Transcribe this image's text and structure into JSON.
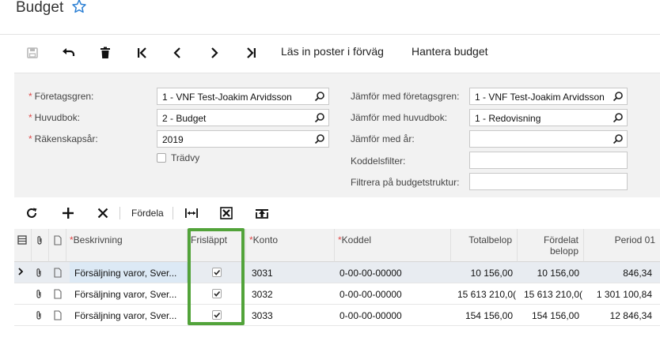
{
  "app": {
    "title": "Budget",
    "favorite_icon": "star-outline-icon",
    "accent": "#2a7fd4"
  },
  "toolbar": {
    "save_icon": "save-icon",
    "undo_icon": "undo-icon",
    "delete_icon": "trash-icon",
    "first_icon": "first-record-icon",
    "prev_icon": "previous-icon",
    "next_icon": "next-icon",
    "last_icon": "last-record-icon",
    "preload_label": "Läs in poster i förväg",
    "manage_label": "Hantera budget"
  },
  "form": {
    "branch": {
      "label": "Företagsgren:",
      "value": "1 - VNF Test-Joakim Arvidsson"
    },
    "ledger": {
      "label": "Huvudbok:",
      "value": "2 - Budget"
    },
    "fiscal_year": {
      "label": "Räkenskapsår:",
      "value": "2019"
    },
    "tree_view": {
      "label": "Trädvy",
      "checked": false
    },
    "compare_branch": {
      "label": "Jämför med företagsgren:",
      "value": "1 - VNF Test-Joakim Arvidsson"
    },
    "compare_ledger": {
      "label": "Jämför med huvudbok:",
      "value": "1 - Redovisning"
    },
    "compare_year": {
      "label": "Jämför med år:",
      "value": ""
    },
    "subaccount_filter": {
      "label": "Koddelsfilter:",
      "value": ""
    },
    "budget_structure_filter": {
      "label": "Filtrera på budgetstruktur:",
      "value": ""
    }
  },
  "grid_toolbar": {
    "refresh_icon": "refresh-icon",
    "add_icon": "plus-icon",
    "remove_icon": "close-icon",
    "distribute_label": "Fördela",
    "fit_icon": "fit-columns-icon",
    "export_icon": "excel-export-icon",
    "upload_icon": "upload-icon"
  },
  "grid": {
    "headers": {
      "description": "Beskrivning",
      "released": "Frisläppt",
      "account": "Konto",
      "subaccount": "Koddel",
      "total": "Totalbelop",
      "distributed": "Fördelat belopp",
      "period01": "Period 01"
    },
    "rows": [
      {
        "description": "Försäljning varor, Sver...",
        "released": true,
        "account": "3031",
        "subaccount": "0-00-00-00000",
        "total": "10 156,00",
        "distributed": "10 156,00",
        "period01": "846,34"
      },
      {
        "description": "Försäljning varor, Sver...",
        "released": true,
        "account": "3032",
        "subaccount": "0-00-00-00000",
        "total": "15 613 210,0(",
        "distributed": "15 613 210,0(",
        "period01": "1 301 100,84"
      },
      {
        "description": "Försäljning varor, Sver...",
        "released": true,
        "account": "3033",
        "subaccount": "0-00-00-00000",
        "total": "154 156,00",
        "distributed": "154 156,00",
        "period01": "12 846,34"
      }
    ]
  }
}
